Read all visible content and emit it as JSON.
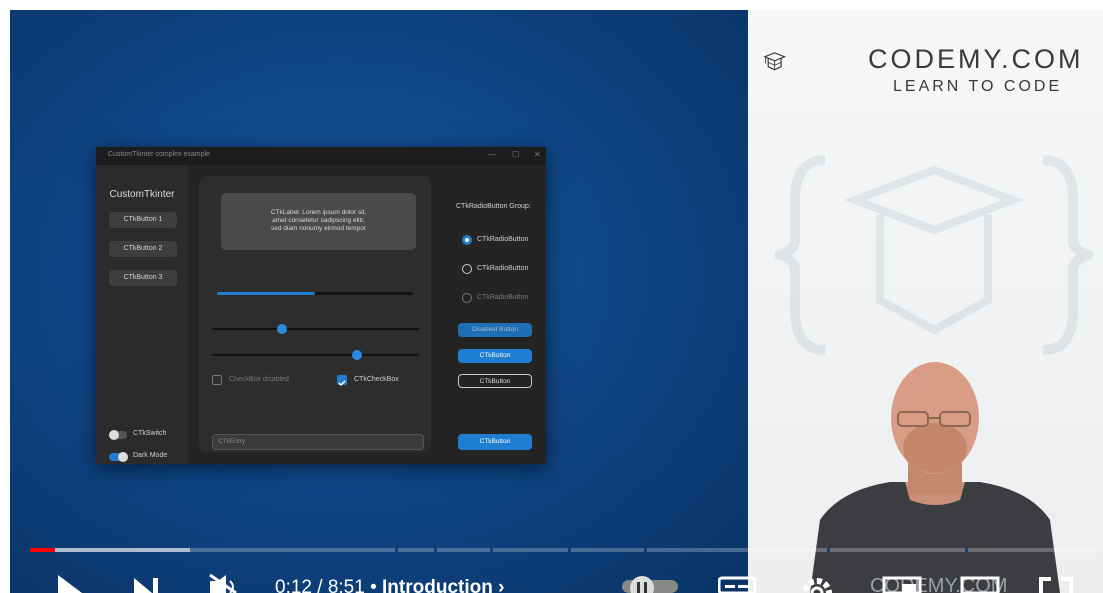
{
  "brand": {
    "name": "CODEMY.COM",
    "tagline": "LEARN TO CODE",
    "shirt_text": "CODEMY.COM"
  },
  "app": {
    "window_title": "CustomTkinter complex example",
    "sidebar": {
      "title": "CustomTkinter",
      "buttons": [
        "CTkButton 1",
        "CTkButton 2",
        "CTkButton 3"
      ],
      "switch_label": "CTkSwitch",
      "dark_mode_label": "Dark Mode"
    },
    "main": {
      "label_text": [
        "CTkLabel: Lorem ipsum dolor sit,",
        "amet consetetur sadipscing elitr,",
        "sed diam nonumy eirmod tempor"
      ],
      "progress": 0.5,
      "slider1": 0.34,
      "slider2": 0.7,
      "checkbox_disabled": "CheckBox disabled",
      "checkbox": "CTkCheckBox",
      "entry_placeholder": "CTkEntry"
    },
    "right": {
      "radio_group_title": "CTkRadioButton Group:",
      "radios": [
        "CTkRadioButton",
        "CTkRadioButton",
        "CTkRadioButton"
      ],
      "disabled_button": "Disabled Button",
      "button1": "CTkButton",
      "button2": "CTkButton",
      "button3": "CTkButton"
    }
  },
  "player": {
    "current_time": "0:12",
    "duration": "8:51",
    "chapter": "Introduction",
    "progress": 0.023,
    "buffered": 0.15,
    "accent": "#ff0000"
  },
  "icons": [
    "play-icon",
    "next-icon",
    "mute-icon",
    "autoplay-toggle-icon",
    "subtitles-icon",
    "settings-icon",
    "miniplayer-icon",
    "theater-icon",
    "fullscreen-icon"
  ]
}
